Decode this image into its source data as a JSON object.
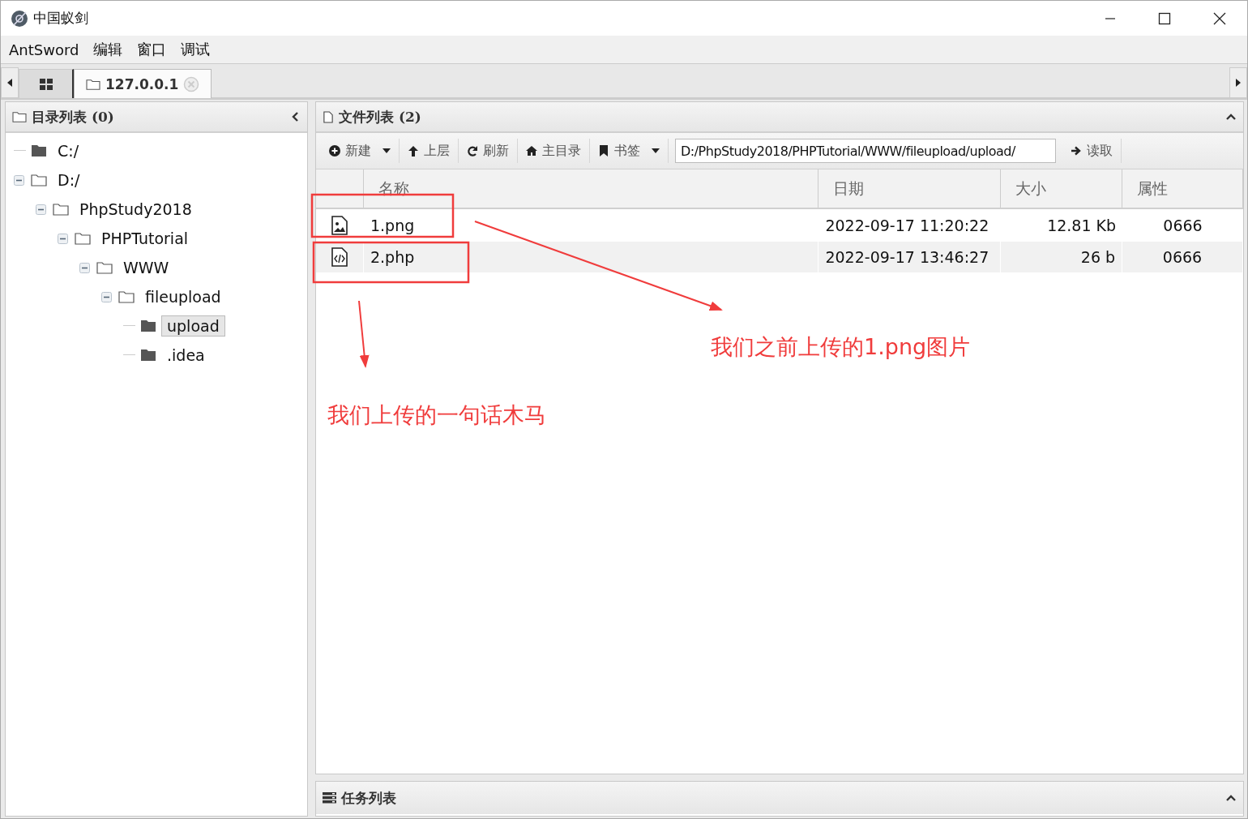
{
  "window": {
    "title": "中国蚁剑"
  },
  "menu": [
    "AntSword",
    "编辑",
    "窗口",
    "调试"
  ],
  "tabs": [
    {
      "kind": "grid",
      "selected": false
    },
    {
      "kind": "folder",
      "label": "127.0.0.1",
      "selected": true
    }
  ],
  "directory_panel": {
    "title": "目录列表 (0)",
    "tree": [
      {
        "label": "C:/",
        "expanded": false,
        "selected": false
      },
      {
        "label": "D:/",
        "expanded": true,
        "selected": false,
        "children": [
          {
            "label": "PhpStudy2018",
            "expanded": true,
            "selected": false,
            "children": [
              {
                "label": "PHPTutorial",
                "expanded": true,
                "selected": false,
                "children": [
                  {
                    "label": "WWW",
                    "expanded": true,
                    "selected": false,
                    "children": [
                      {
                        "label": "fileupload",
                        "expanded": true,
                        "selected": false,
                        "children": [
                          {
                            "label": "upload",
                            "expanded": false,
                            "selected": true
                          },
                          {
                            "label": ".idea",
                            "expanded": false,
                            "selected": false
                          }
                        ]
                      }
                    ]
                  }
                ]
              }
            ]
          }
        ]
      }
    ]
  },
  "file_panel": {
    "title": "文件列表 (2)",
    "toolbar": {
      "buttons": [
        {
          "label": "新建",
          "dropdown": true
        },
        {
          "label": "上层",
          "dropdown": false
        },
        {
          "label": "刷新",
          "dropdown": false
        },
        {
          "label": "主目录",
          "dropdown": false
        },
        {
          "label": "书签",
          "dropdown": true
        }
      ],
      "path_field": {
        "value": "D:/PhpStudy2018/PHPTutorial/WWW/fileupload/upload/"
      },
      "read_button": {
        "label": "读取"
      }
    },
    "columns": [
      "名称",
      "日期",
      "大小",
      "属性"
    ],
    "rows": [
      {
        "kind": "image",
        "name": "1.png",
        "date": "2022-09-17 11:20:22",
        "size": "12.81 Kb",
        "attributes": "0666"
      },
      {
        "kind": "code",
        "name": "2.php",
        "date": "2022-09-17 13:46:27",
        "size": "26 b",
        "attributes": "0666"
      }
    ]
  },
  "task_panel": {
    "title": "任务列表"
  },
  "annotations": [
    {
      "text": "我们之前上传的1.png图片"
    },
    {
      "text": "我们上传的一句话木马"
    }
  ]
}
